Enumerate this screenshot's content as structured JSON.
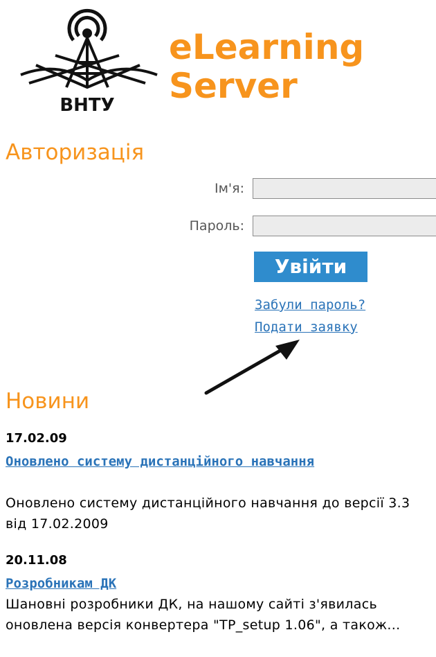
{
  "header": {
    "brand_line1": "eLearning",
    "brand_line2": "Server",
    "logo_text": "ВНТУ",
    "brand_color": "#f7941d"
  },
  "auth": {
    "title": "Авторизація",
    "name_label": "Ім'я:",
    "name_value": "",
    "password_label": "Пароль:",
    "password_value": "",
    "login_button": "Увійти",
    "button_color": "#2f8ccd",
    "forgot_link": "Забули пароль?",
    "apply_link": "Подати заявку",
    "link_color": "#2a73b8"
  },
  "annotation": {
    "icon": "arrow-icon"
  },
  "news": {
    "title": "Новини",
    "items": [
      {
        "date": "17.02.09",
        "title": "Оновлено систему дистанційного навчання",
        "text": "Оновлено систему дистанційного навчання до версії 3.3 від 17.02.2009"
      },
      {
        "date": "20.11.08",
        "title": "Розробникам ДК",
        "text": "Шановні розробники ДК, на нашому сайті з'явилась оновлена версія конвертера \"TP_setup 1.06\", а також..."
      }
    ]
  }
}
